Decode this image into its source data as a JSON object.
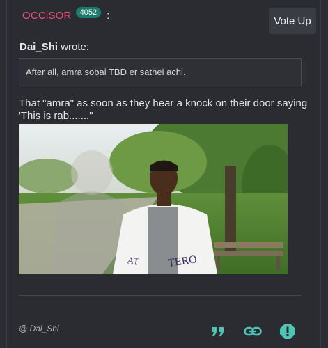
{
  "post": {
    "username": "OCCiSOR",
    "reputation": "4052",
    "colon": ":",
    "vote_button": "Vote Up"
  },
  "quote": {
    "author": "Dai_Shi",
    "wrote": " wrote:",
    "text": "After all, amra sobai TBD er sathei achi."
  },
  "body": {
    "text": "That \"amra\" as soon as they hear a knock on their door saying 'This is rab.......\""
  },
  "footer": {
    "mention": "@ Dai_Shi",
    "icons": [
      "quote-icon",
      "link-icon",
      "report-icon"
    ]
  },
  "colors": {
    "accent_username": "#e8537a",
    "badge": "#1f7a6b",
    "icon_teal": "#4fc3b4"
  }
}
